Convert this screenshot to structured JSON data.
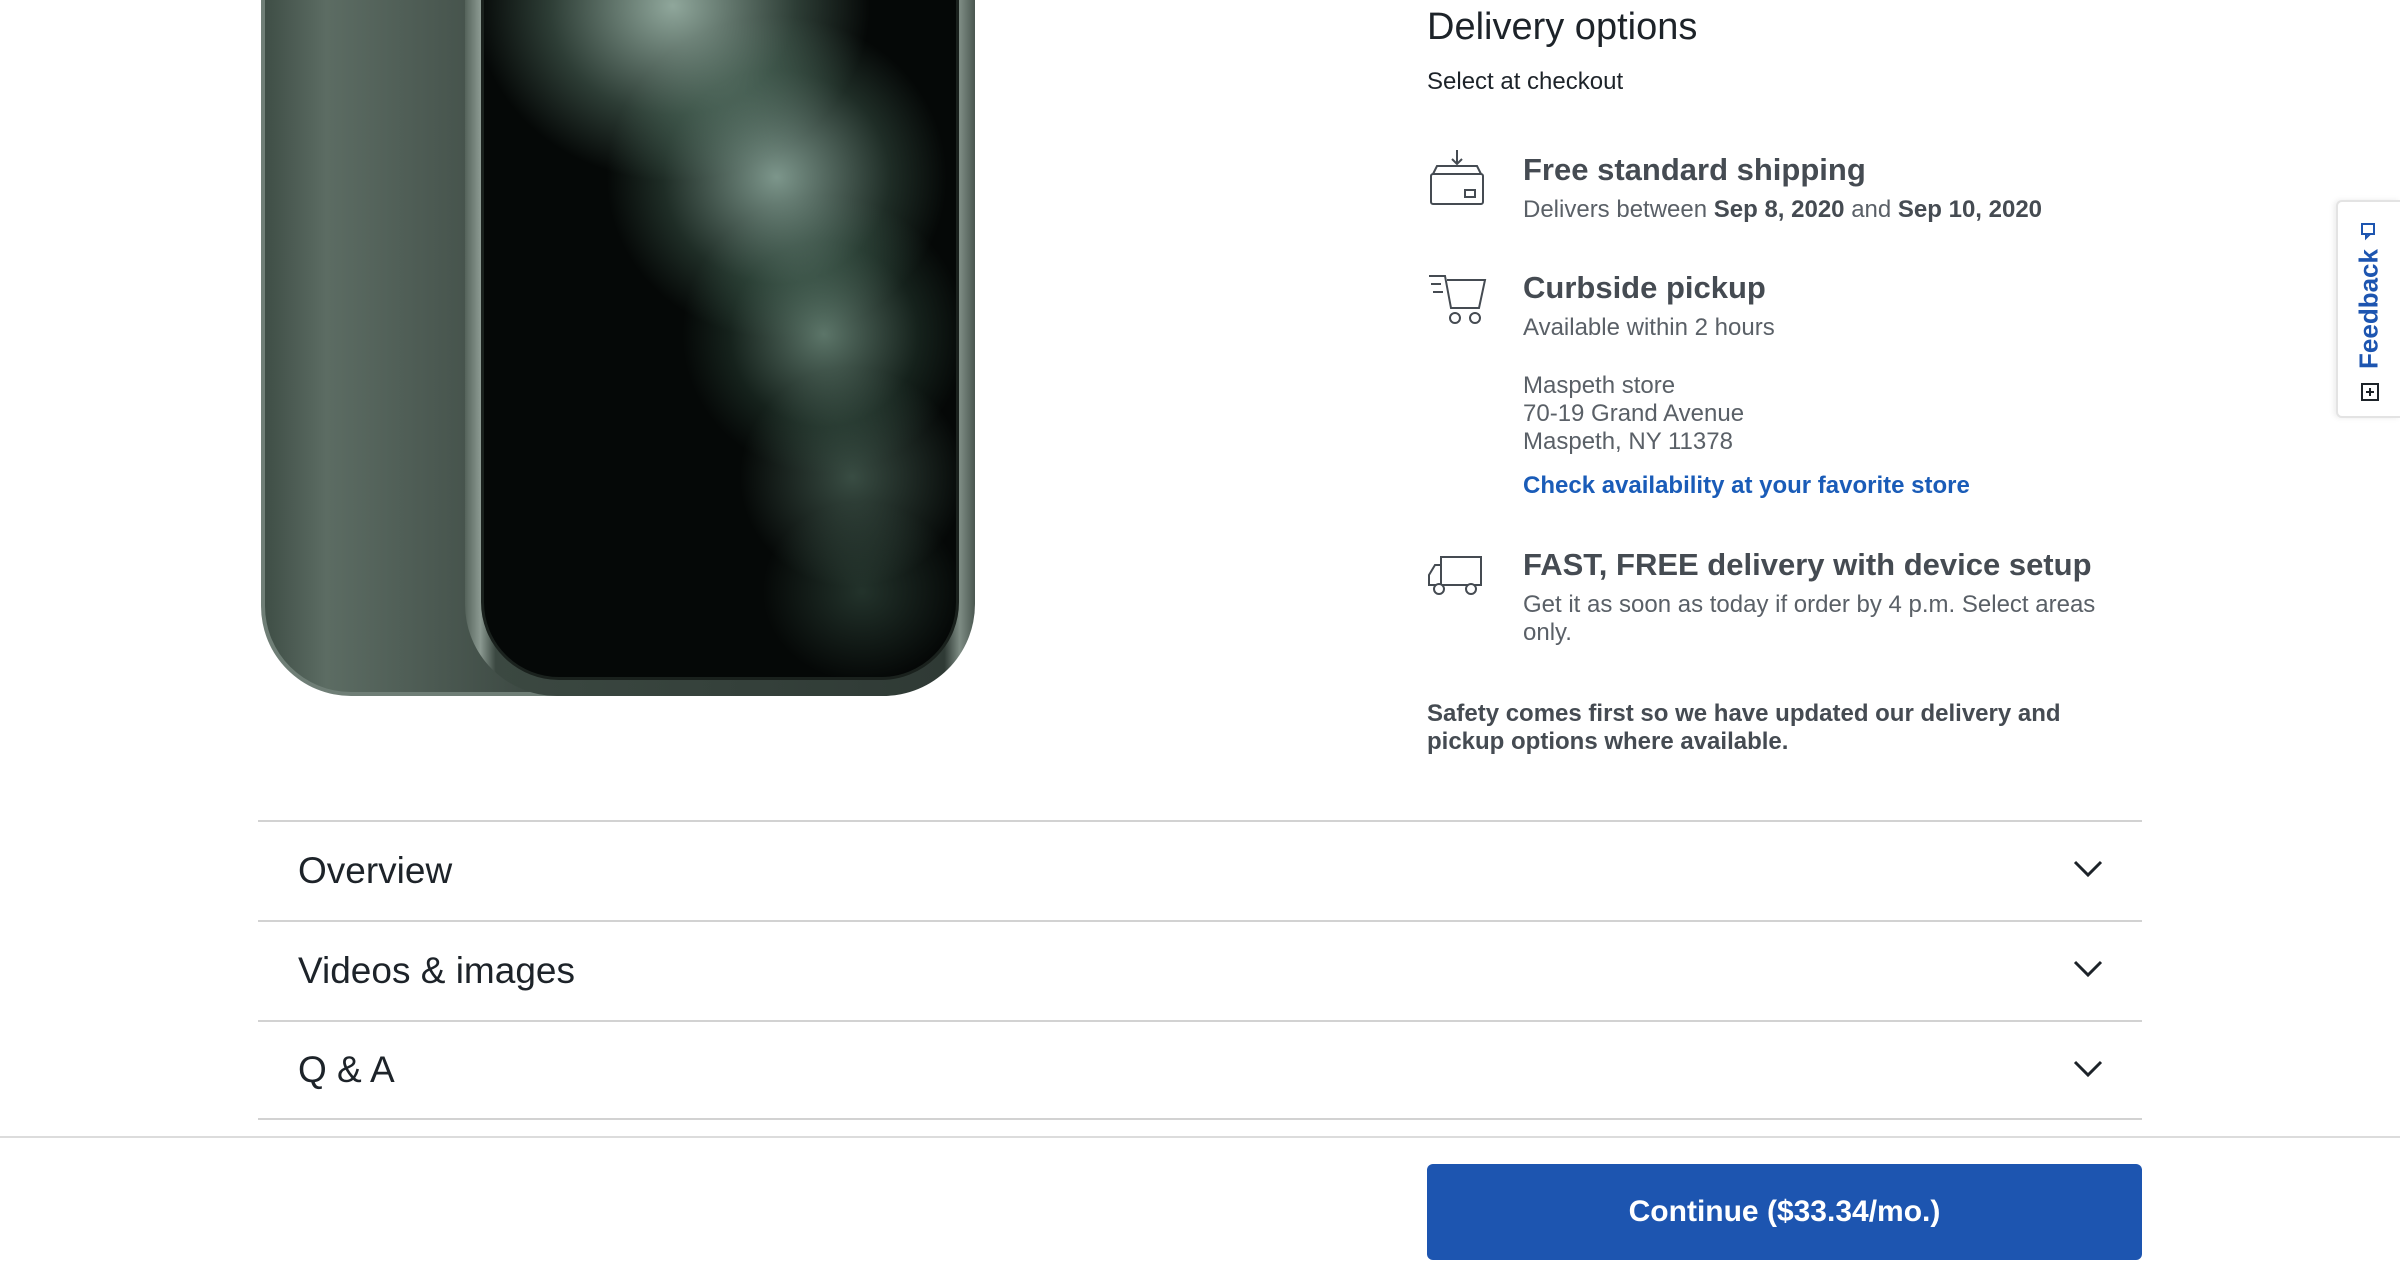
{
  "delivery": {
    "title": "Delivery options",
    "subtitle": "Select at checkout",
    "options": [
      {
        "icon": "package-box-icon",
        "title": "Free standard shipping",
        "desc_prefix": "Delivers between ",
        "date_start": "Sep 8, 2020",
        "desc_mid": " and ",
        "date_end": "Sep 10, 2020"
      },
      {
        "icon": "shopping-cart-icon",
        "title": "Curbside pickup",
        "desc": "Available within 2 hours",
        "store_name": "Maspeth store",
        "store_address": "70-19 Grand Avenue",
        "store_city": "Maspeth, NY 11378",
        "link": "Check availability at your favorite store"
      },
      {
        "icon": "delivery-truck-icon",
        "title": "FAST, FREE delivery with device setup",
        "desc": "Get it as soon as today if order by 4 p.m. Select areas only."
      }
    ],
    "safety_note": "Safety comes first so we have updated our delivery and pickup options where available."
  },
  "accordion": [
    {
      "label": "Overview"
    },
    {
      "label": "Videos & images"
    },
    {
      "label": "Q & A"
    }
  ],
  "cta": {
    "label": "Continue ($33.34/mo.)"
  },
  "feedback": {
    "label": "Feedback"
  },
  "colors": {
    "accent": "#1d55b0",
    "link": "#1a5cb8",
    "text": "#1d2329",
    "muted": "#5a6067"
  }
}
